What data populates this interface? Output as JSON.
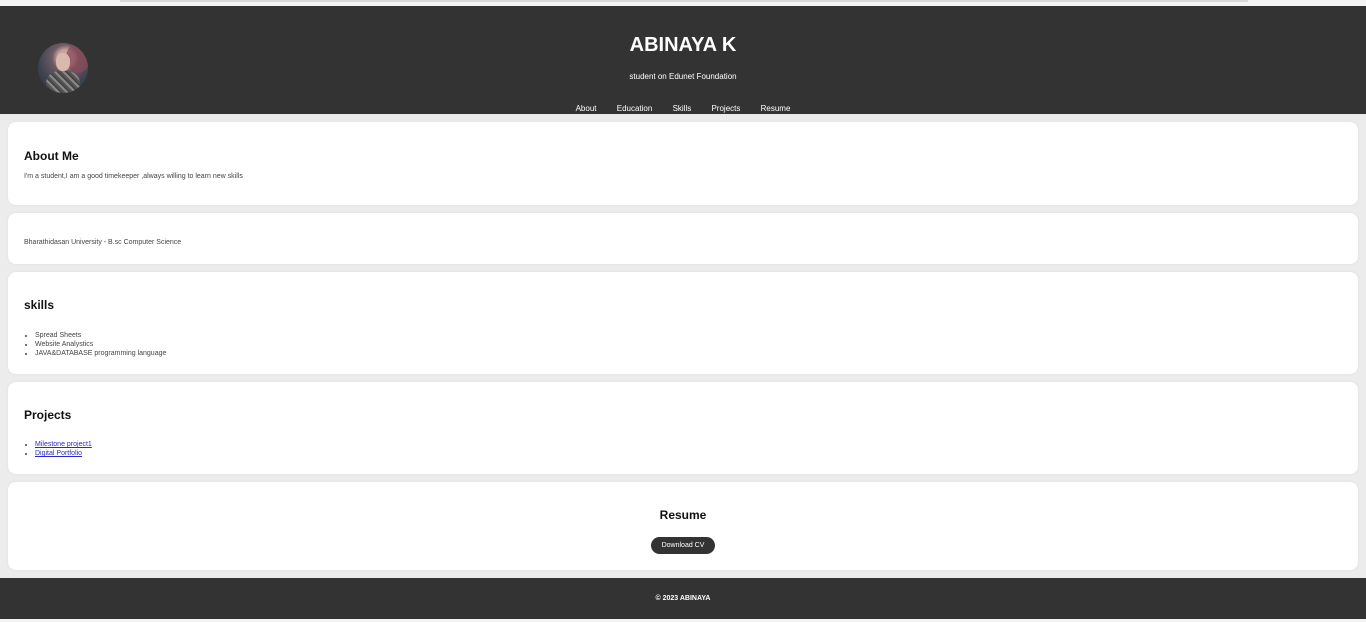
{
  "header": {
    "title": "ABINAYA K",
    "subtitle": "student on Edunet Foundation",
    "avatar_icon": "profile-photo"
  },
  "nav": {
    "items": [
      "About",
      "Education",
      "Skills",
      "Projects",
      "Resume"
    ]
  },
  "about": {
    "heading": "About Me",
    "text": "I'm a student,I am a good timekeeper ,always willing to learn new skills"
  },
  "education": {
    "text": "Bharathidasan University - B.sc Computer Science"
  },
  "skills": {
    "heading": "skills",
    "items": [
      "Spread Sheets",
      "Website Analystics",
      "JAVA&DATABASE programming language"
    ]
  },
  "projects": {
    "heading": "Projects",
    "items": [
      "Milestone project1",
      "Digital Portfolio"
    ]
  },
  "resume": {
    "heading": "Resume",
    "button_label": "Download CV"
  },
  "footer": {
    "text": "© 2023 ABINAYA"
  },
  "colors": {
    "header_bg": "#333333",
    "page_bg": "#ececec",
    "card_bg": "#ffffff",
    "link": "#2b2bcc"
  }
}
